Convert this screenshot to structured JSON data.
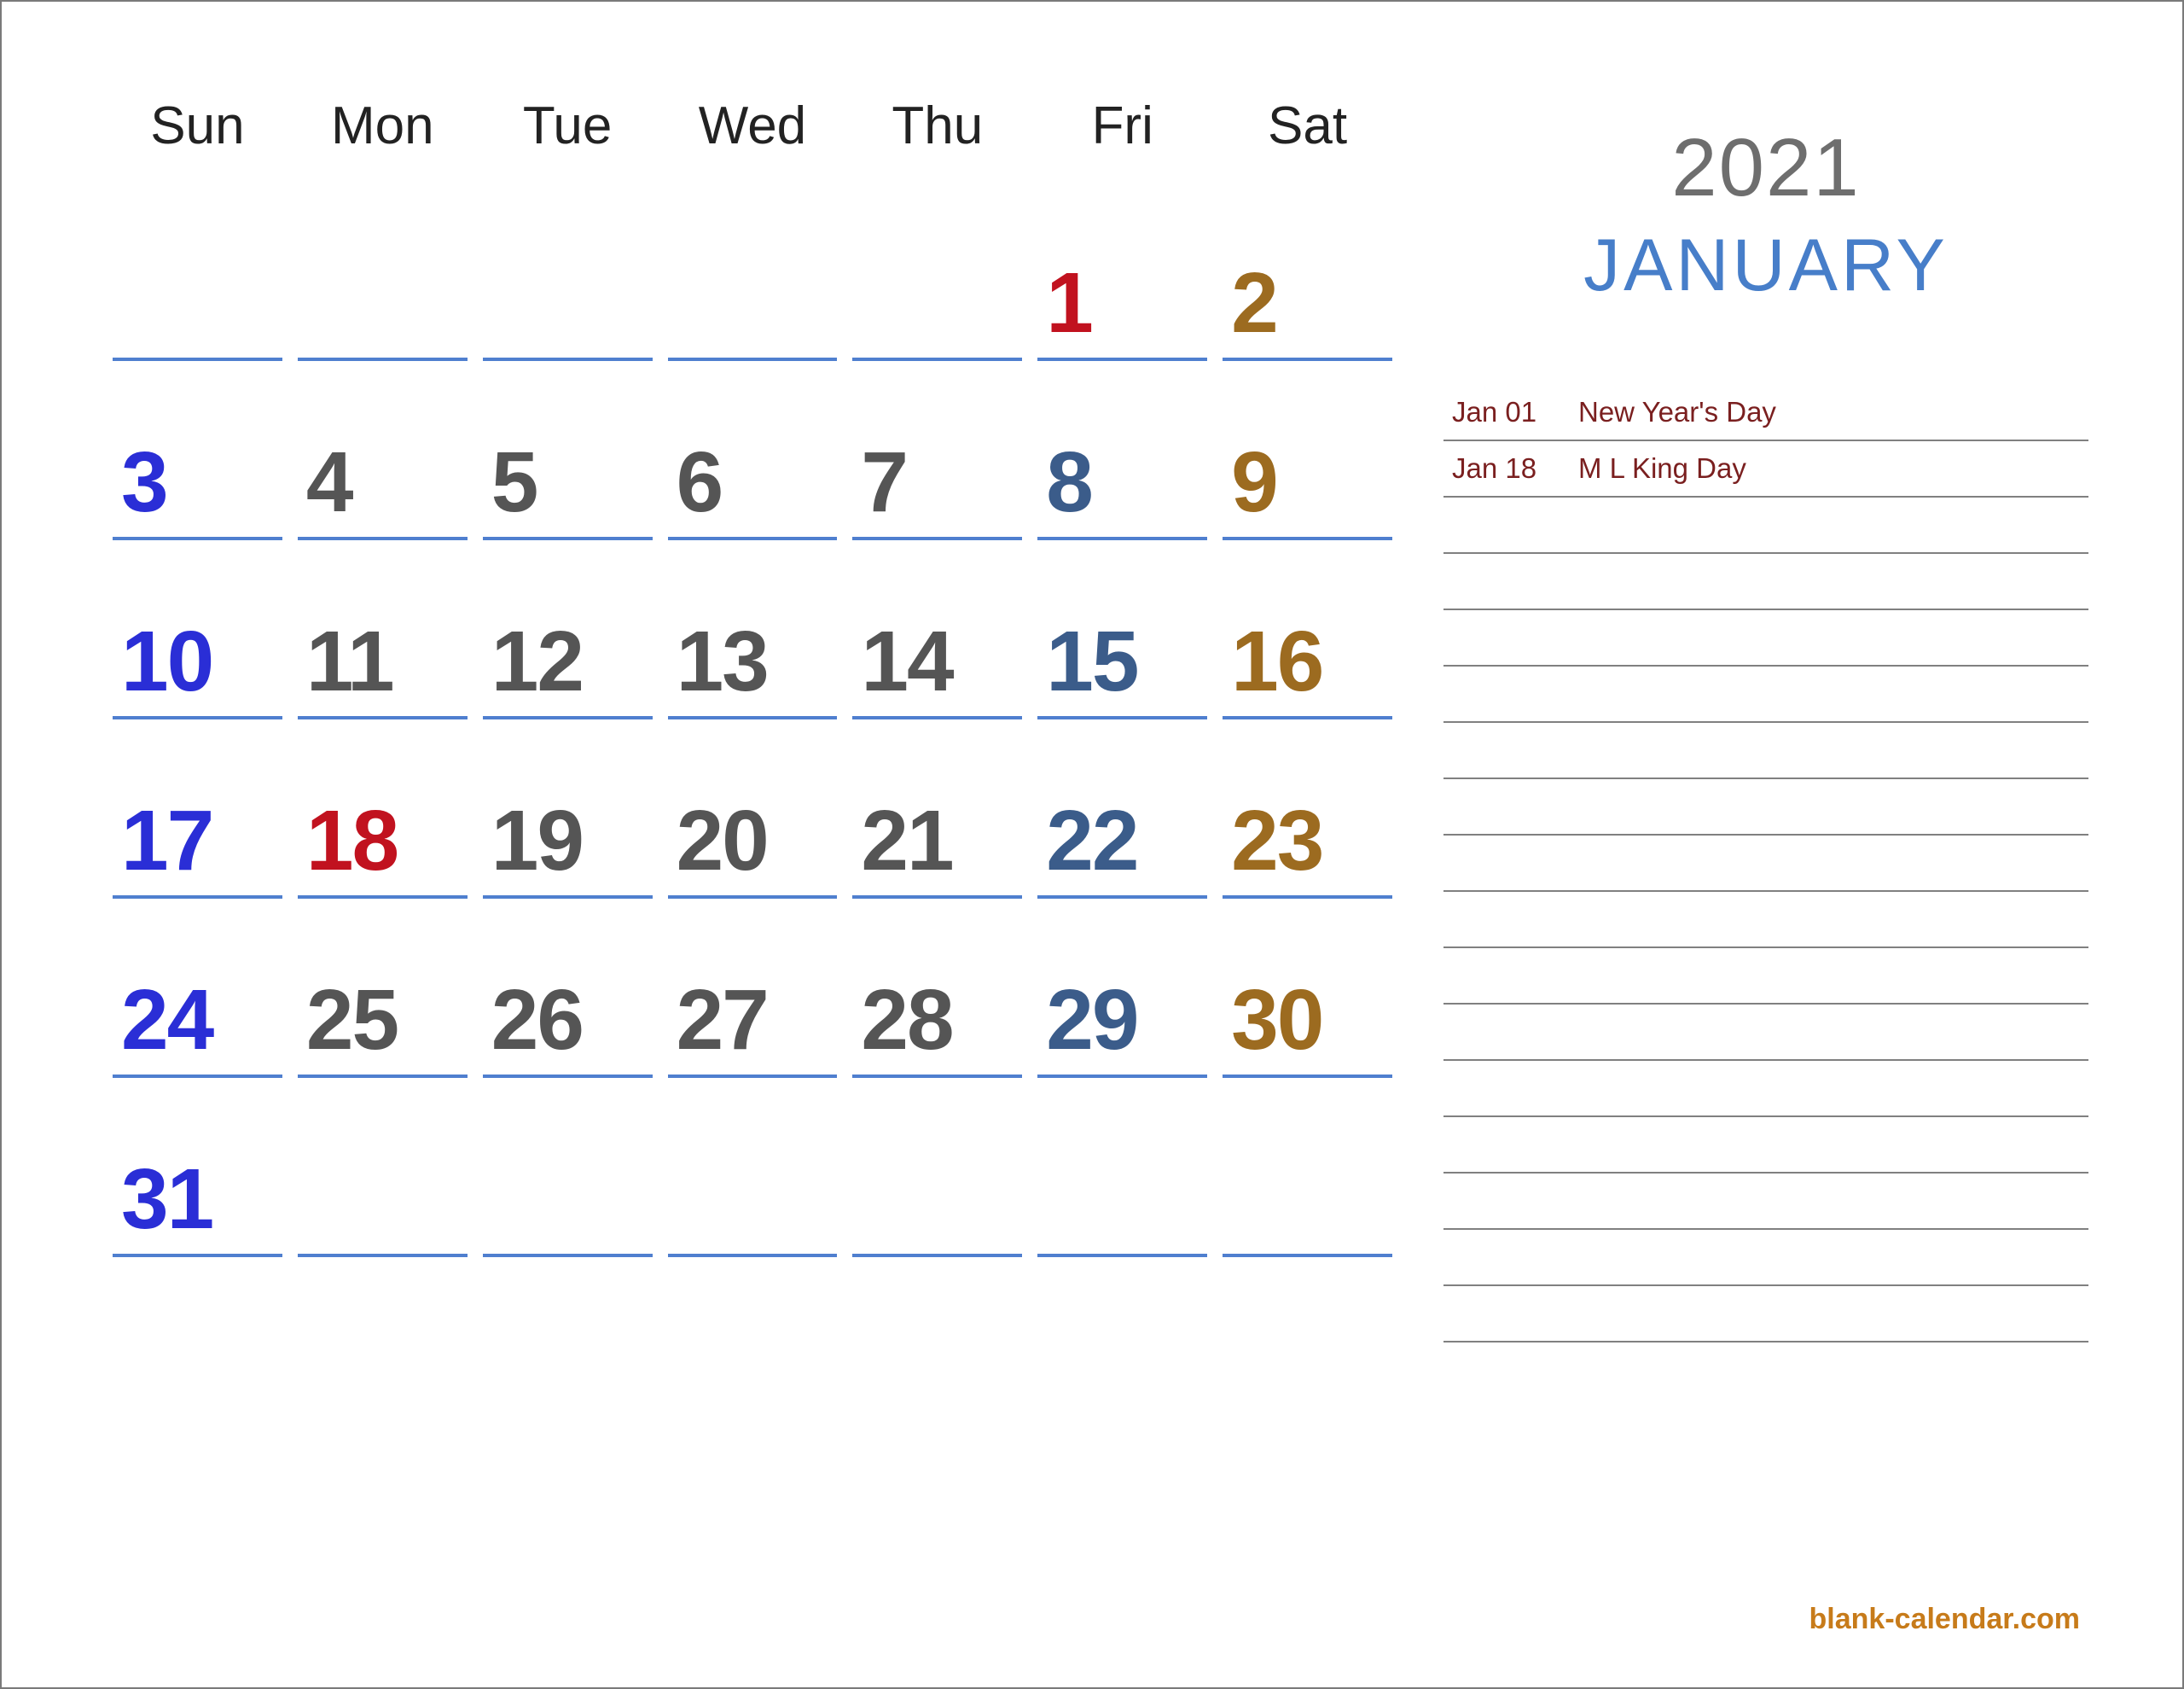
{
  "calendar": {
    "year": "2021",
    "month": "JANUARY",
    "dow": [
      "Sun",
      "Mon",
      "Tue",
      "Wed",
      "Thu",
      "Fri",
      "Sat"
    ],
    "weeks": [
      [
        {
          "d": "",
          "cls": ""
        },
        {
          "d": "",
          "cls": ""
        },
        {
          "d": "",
          "cls": ""
        },
        {
          "d": "",
          "cls": ""
        },
        {
          "d": "",
          "cls": ""
        },
        {
          "d": "1",
          "cls": "c-hol"
        },
        {
          "d": "2",
          "cls": "c-sat"
        }
      ],
      [
        {
          "d": "3",
          "cls": "c-sun"
        },
        {
          "d": "4",
          "cls": "c-week"
        },
        {
          "d": "5",
          "cls": "c-week"
        },
        {
          "d": "6",
          "cls": "c-week"
        },
        {
          "d": "7",
          "cls": "c-week"
        },
        {
          "d": "8",
          "cls": "c-fri"
        },
        {
          "d": "9",
          "cls": "c-sat"
        }
      ],
      [
        {
          "d": "10",
          "cls": "c-sun"
        },
        {
          "d": "11",
          "cls": "c-week"
        },
        {
          "d": "12",
          "cls": "c-week"
        },
        {
          "d": "13",
          "cls": "c-week"
        },
        {
          "d": "14",
          "cls": "c-week"
        },
        {
          "d": "15",
          "cls": "c-fri"
        },
        {
          "d": "16",
          "cls": "c-sat"
        }
      ],
      [
        {
          "d": "17",
          "cls": "c-sun"
        },
        {
          "d": "18",
          "cls": "c-hol"
        },
        {
          "d": "19",
          "cls": "c-week"
        },
        {
          "d": "20",
          "cls": "c-week"
        },
        {
          "d": "21",
          "cls": "c-week"
        },
        {
          "d": "22",
          "cls": "c-fri"
        },
        {
          "d": "23",
          "cls": "c-sat"
        }
      ],
      [
        {
          "d": "24",
          "cls": "c-sun"
        },
        {
          "d": "25",
          "cls": "c-week"
        },
        {
          "d": "26",
          "cls": "c-week"
        },
        {
          "d": "27",
          "cls": "c-week"
        },
        {
          "d": "28",
          "cls": "c-week"
        },
        {
          "d": "29",
          "cls": "c-fri"
        },
        {
          "d": "30",
          "cls": "c-sat"
        }
      ],
      [
        {
          "d": "31",
          "cls": "c-sun"
        },
        {
          "d": "",
          "cls": ""
        },
        {
          "d": "",
          "cls": ""
        },
        {
          "d": "",
          "cls": ""
        },
        {
          "d": "",
          "cls": ""
        },
        {
          "d": "",
          "cls": ""
        },
        {
          "d": "",
          "cls": ""
        }
      ]
    ]
  },
  "holidays": [
    {
      "date": "Jan 01",
      "name": "New Year's Day"
    },
    {
      "date": "Jan 18",
      "name": "M L King Day"
    }
  ],
  "blank_lines": 15,
  "footer": "blank-calendar.com"
}
